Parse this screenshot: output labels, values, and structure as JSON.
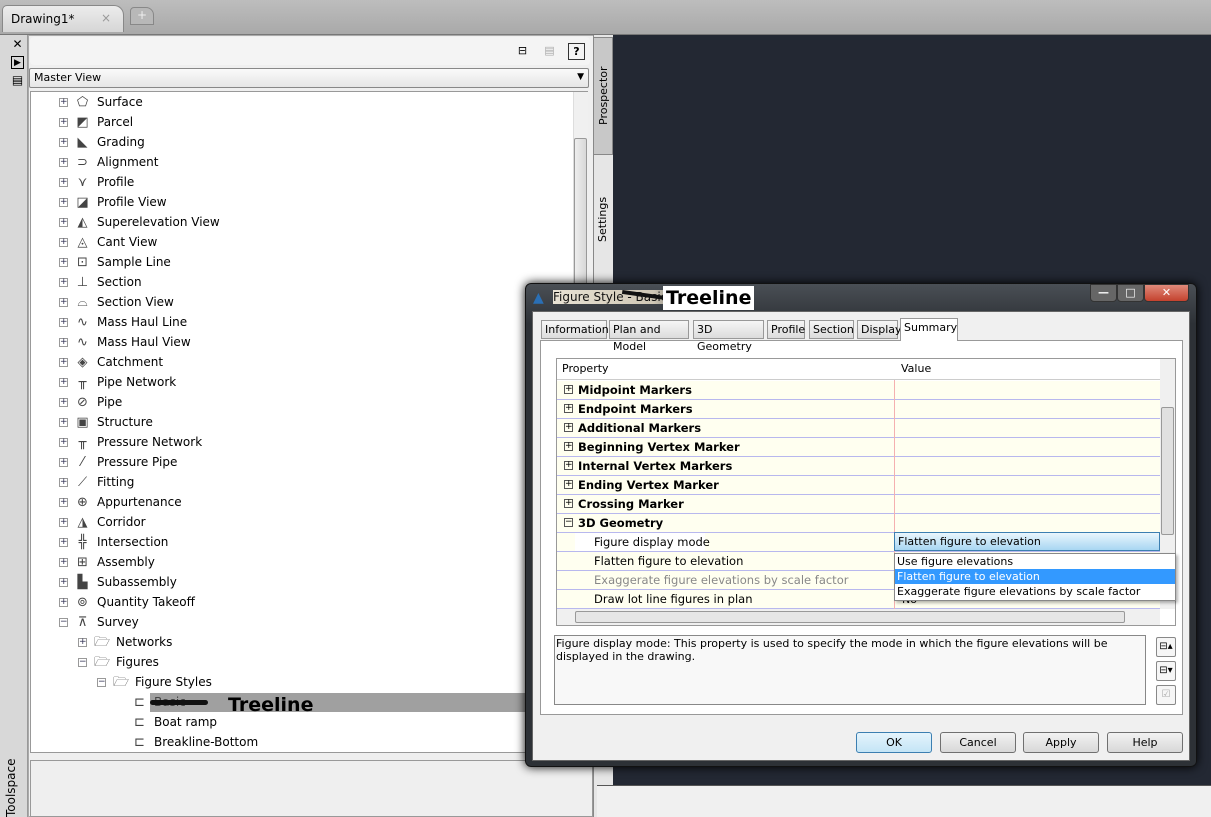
{
  "document_tab": {
    "title": "Drawing1*",
    "close": "×",
    "new_tab": "+"
  },
  "left_strip": {
    "close": "✕",
    "autohide": "▶",
    "properties": "▤",
    "palette_name": "Toolspace"
  },
  "toolbar": {
    "icons": [
      "item-view-icon",
      "preview-icon",
      "help-icon"
    ],
    "help_label": "?"
  },
  "view_select": {
    "value": "Master View"
  },
  "vertical_tabs": [
    "Prospector",
    "Settings"
  ],
  "tree": [
    {
      "label": "Surface",
      "level": 0,
      "exp": "+",
      "icon": "⬠"
    },
    {
      "label": "Parcel",
      "level": 0,
      "exp": "+",
      "icon": "◩"
    },
    {
      "label": "Grading",
      "level": 0,
      "exp": "+",
      "icon": "◣"
    },
    {
      "label": "Alignment",
      "level": 0,
      "exp": "+",
      "icon": "⊃"
    },
    {
      "label": "Profile",
      "level": 0,
      "exp": "+",
      "icon": "⋎"
    },
    {
      "label": "Profile View",
      "level": 0,
      "exp": "+",
      "icon": "◪"
    },
    {
      "label": "Superelevation View",
      "level": 0,
      "exp": "+",
      "icon": "◭"
    },
    {
      "label": "Cant View",
      "level": 0,
      "exp": "+",
      "icon": "◬"
    },
    {
      "label": "Sample Line",
      "level": 0,
      "exp": "+",
      "icon": "⊡"
    },
    {
      "label": "Section",
      "level": 0,
      "exp": "+",
      "icon": "⊥"
    },
    {
      "label": "Section View",
      "level": 0,
      "exp": "+",
      "icon": "⌓"
    },
    {
      "label": "Mass Haul Line",
      "level": 0,
      "exp": "+",
      "icon": "∿"
    },
    {
      "label": "Mass Haul View",
      "level": 0,
      "exp": "+",
      "icon": "∿"
    },
    {
      "label": "Catchment",
      "level": 0,
      "exp": "+",
      "icon": "◈"
    },
    {
      "label": "Pipe Network",
      "level": 0,
      "exp": "+",
      "icon": "╥"
    },
    {
      "label": "Pipe",
      "level": 0,
      "exp": "+",
      "icon": "⊘"
    },
    {
      "label": "Structure",
      "level": 0,
      "exp": "+",
      "icon": "▣"
    },
    {
      "label": "Pressure Network",
      "level": 0,
      "exp": "+",
      "icon": "╥"
    },
    {
      "label": "Pressure Pipe",
      "level": 0,
      "exp": "+",
      "icon": "⁄"
    },
    {
      "label": "Fitting",
      "level": 0,
      "exp": "+",
      "icon": "⟋"
    },
    {
      "label": "Appurtenance",
      "level": 0,
      "exp": "+",
      "icon": "⊕"
    },
    {
      "label": "Corridor",
      "level": 0,
      "exp": "+",
      "icon": "◮"
    },
    {
      "label": "Intersection",
      "level": 0,
      "exp": "+",
      "icon": "╬"
    },
    {
      "label": "Assembly",
      "level": 0,
      "exp": "+",
      "icon": "⊞"
    },
    {
      "label": "Subassembly",
      "level": 0,
      "exp": "+",
      "icon": "▙"
    },
    {
      "label": "Quantity Takeoff",
      "level": 0,
      "exp": "+",
      "icon": "⊚"
    },
    {
      "label": "Survey",
      "level": 0,
      "exp": "−",
      "icon": "⊼"
    },
    {
      "label": "Networks",
      "level": 1,
      "exp": "+",
      "icon": "🗁"
    },
    {
      "label": "Figures",
      "level": 1,
      "exp": "−",
      "icon": "🗁"
    },
    {
      "label": "Figure Styles",
      "level": 2,
      "exp": "−",
      "icon": "🗁"
    },
    {
      "label": "Basic",
      "level": 3,
      "exp": "",
      "icon": "⊏",
      "selected": true
    },
    {
      "label": "Boat ramp",
      "level": 3,
      "exp": "",
      "icon": "⊏"
    },
    {
      "label": "Breakline-Bottom",
      "level": 3,
      "exp": "",
      "icon": "⊏"
    }
  ],
  "annotation": "Treeline",
  "dialog": {
    "title": "Figure Style - Basic",
    "title_overlay": "Treeline",
    "window_buttons": [
      "—",
      "□",
      "✕"
    ],
    "tabs": [
      "Information",
      "Plan and Model",
      "3D Geometry",
      "Profile",
      "Section",
      "Display",
      "Summary"
    ],
    "active_tab": "Summary",
    "grid": {
      "headers": [
        "Property",
        "Value"
      ],
      "rows": [
        {
          "label": "Midpoint Markers",
          "type": "cat",
          "exp": "+"
        },
        {
          "label": "Endpoint Markers",
          "type": "cat",
          "exp": "+"
        },
        {
          "label": "Additional Markers",
          "type": "cat",
          "exp": "+"
        },
        {
          "label": "Beginning Vertex Marker",
          "type": "cat",
          "exp": "+"
        },
        {
          "label": "Internal Vertex Markers",
          "type": "cat",
          "exp": "+"
        },
        {
          "label": "Ending Vertex Marker",
          "type": "cat",
          "exp": "+"
        },
        {
          "label": "Crossing Marker",
          "type": "cat",
          "exp": "+"
        },
        {
          "label": "3D Geometry",
          "type": "cat",
          "exp": "−"
        },
        {
          "label": "Figure display mode",
          "type": "sub",
          "value": "Flatten figure to elevation"
        },
        {
          "label": "Flatten figure to elevation",
          "type": "sub",
          "value": ""
        },
        {
          "label": "Exaggerate figure elevations by scale factor",
          "type": "sub",
          "disabled": true,
          "value": ""
        },
        {
          "label": "Draw lot line figures in plan",
          "type": "sub",
          "value": "No"
        }
      ],
      "dropdown_options": [
        "Use figure elevations",
        "Flatten figure to elevation",
        "Exaggerate figure elevations by scale factor"
      ],
      "dropdown_selected": 1
    },
    "description": "Figure display mode: This property is used to specify the mode in which the figure elevations will be displayed in the drawing.",
    "side_icons": [
      "collapse-all-icon",
      "expand-all-icon",
      "override-icon"
    ],
    "buttons": {
      "ok": "OK",
      "cancel": "Cancel",
      "apply": "Apply",
      "help": "Help"
    }
  },
  "colors": {
    "canvas": "#232833",
    "selection": "#3399ff",
    "grid_row": "#fffff0",
    "tree_selection": "#a0a0a0"
  }
}
